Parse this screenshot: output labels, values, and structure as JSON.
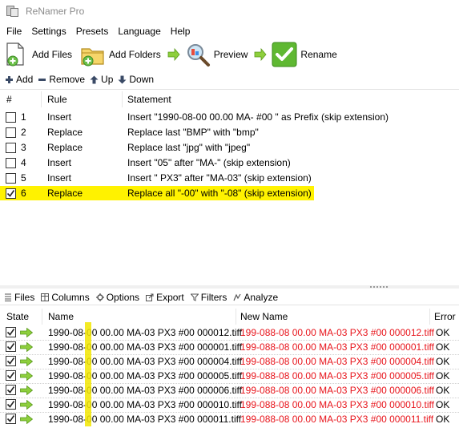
{
  "window": {
    "title": "ReNamer Pro"
  },
  "menu": [
    "File",
    "Settings",
    "Presets",
    "Language",
    "Help"
  ],
  "toolbar": {
    "add_files": "Add Files",
    "add_folders": "Add Folders",
    "preview": "Preview",
    "rename": "Rename"
  },
  "rules_toolbar": {
    "add": "Add",
    "remove": "Remove",
    "up": "Up",
    "down": "Down"
  },
  "rules": {
    "columns": {
      "num": "#",
      "rule": "Rule",
      "statement": "Statement"
    },
    "rows": [
      {
        "checked": false,
        "num": "1",
        "rule": "Insert",
        "statement": "Insert \"1990-08-00 00.00 MA- #00 \" as Prefix (skip extension)"
      },
      {
        "checked": false,
        "num": "2",
        "rule": "Replace",
        "statement": "Replace last \"BMP\" with \"bmp\""
      },
      {
        "checked": false,
        "num": "3",
        "rule": "Replace",
        "statement": "Replace last \"jpg\" with \"jpeg\""
      },
      {
        "checked": false,
        "num": "4",
        "rule": "Insert",
        "statement": "Insert \"05\" after \"MA-\" (skip extension)"
      },
      {
        "checked": false,
        "num": "5",
        "rule": "Insert",
        "statement": "Insert \" PX3\" after \"MA-03\" (skip extension)"
      },
      {
        "checked": true,
        "num": "6",
        "rule": "Replace",
        "statement": "Replace all \"-00\" with \"-08\" (skip extension)",
        "highlighted": true
      }
    ]
  },
  "files_toolbar": {
    "files": "Files",
    "columns": "Columns",
    "options": "Options",
    "export": "Export",
    "filters": "Filters",
    "analyze": "Analyze"
  },
  "files": {
    "columns": {
      "state": "State",
      "name": "Name",
      "new_name": "New Name",
      "error": "Error"
    },
    "rows": [
      {
        "name": "1990-08-00 00.00 MA-03 PX3 #00 000012.tiff",
        "new_name": "199-088-08 00.00 MA-03 PX3 #00 000012.tiff",
        "error": "OK"
      },
      {
        "name": "1990-08-00 00.00 MA-03 PX3 #00 000001.tiff",
        "new_name": "199-088-08 00.00 MA-03 PX3 #00 000001.tiff",
        "error": "OK"
      },
      {
        "name": "1990-08-00 00.00 MA-03 PX3 #00 000004.tiff",
        "new_name": "199-088-08 00.00 MA-03 PX3 #00 000004.tiff",
        "error": "OK"
      },
      {
        "name": "1990-08-00 00.00 MA-03 PX3 #00 000005.tiff",
        "new_name": "199-088-08 00.00 MA-03 PX3 #00 000005.tiff",
        "error": "OK"
      },
      {
        "name": "1990-08-00 00.00 MA-03 PX3 #00 000006.tiff",
        "new_name": "199-088-08 00.00 MA-03 PX3 #00 000006.tiff",
        "error": "OK"
      },
      {
        "name": "1990-08-00 00.00 MA-03 PX3 #00 000010.tiff",
        "new_name": "199-088-08 00.00 MA-03 PX3 #00 000010.tiff",
        "error": "OK"
      },
      {
        "name": "1990-08-00 00.00 MA-03 PX3 #00 000011.tiff",
        "new_name": "199-088-08 00.00 MA-03 PX3 #00 000011.tiff",
        "error": "OK"
      }
    ]
  },
  "colors": {
    "new_name": "#e8141b",
    "highlight": "#fff200",
    "accent_green": "#5fb832"
  },
  "icons": [
    "add-files-icon",
    "add-folders-icon",
    "preview-icon",
    "rename-icon",
    "state-arrow-icon"
  ]
}
